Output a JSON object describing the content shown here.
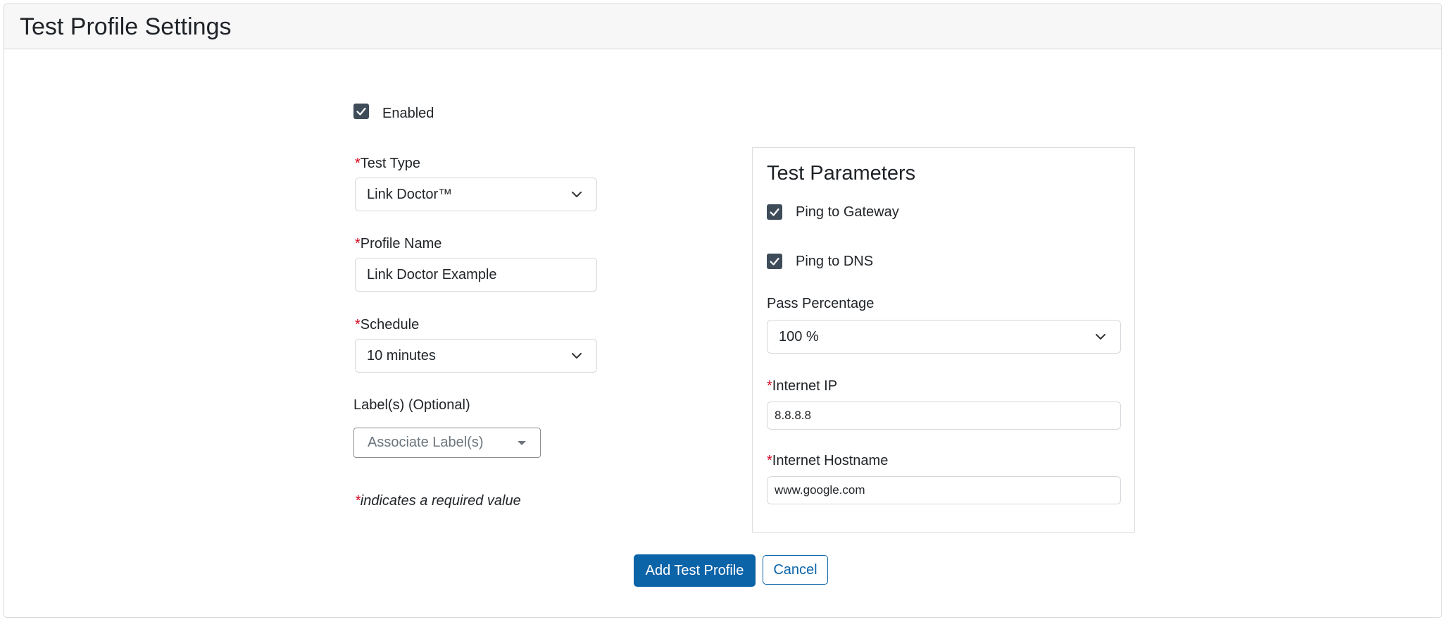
{
  "header": {
    "title": "Test Profile Settings"
  },
  "form": {
    "enabled_label": "Enabled",
    "required_marker": "*",
    "test_type": {
      "label": "Test Type",
      "value": "Link Doctor™"
    },
    "profile_name": {
      "label": "Profile Name",
      "value": "Link Doctor Example"
    },
    "schedule": {
      "label": "Schedule",
      "value": "10 minutes"
    },
    "labels": {
      "label": "Label(s) (Optional)",
      "placeholder": "Associate Label(s)"
    },
    "required_note": "indicates a required value"
  },
  "params": {
    "title": "Test Parameters",
    "ping_gateway_label": "Ping to Gateway",
    "ping_dns_label": "Ping to DNS",
    "pass_percentage": {
      "label": "Pass Percentage",
      "value": "100 %"
    },
    "internet_ip": {
      "label": "Internet IP",
      "value": "8.8.8.8"
    },
    "internet_hostname": {
      "label": "Internet Hostname",
      "value": "www.google.com"
    }
  },
  "actions": {
    "add_label": "Add Test Profile",
    "cancel_label": "Cancel"
  },
  "colors": {
    "primary": "#0b63a8",
    "checkbox": "#3e4c59",
    "required": "#d0021b"
  },
  "icons": {
    "check": "check-icon",
    "chevron": "chevron-down-icon",
    "caret": "caret-down-icon"
  }
}
